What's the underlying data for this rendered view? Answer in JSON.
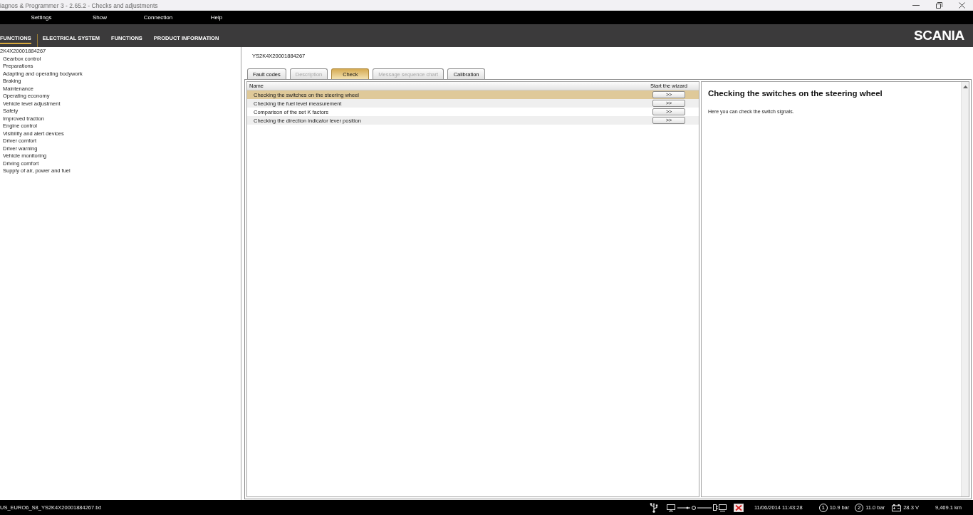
{
  "window": {
    "title": "iagnos & Programmer 3 - 2.65.2 - Checks and adjustments"
  },
  "menu": [
    {
      "label": "Settings"
    },
    {
      "label": "Show"
    },
    {
      "label": "Connection"
    },
    {
      "label": "Help"
    }
  ],
  "nav": {
    "items": [
      {
        "label": "FUNCTIONS",
        "selected": true
      },
      {
        "label": "ELECTRICAL SYSTEM",
        "selected": false
      },
      {
        "label": "FUNCTIONS",
        "selected": false
      },
      {
        "label": "PRODUCT INFORMATION",
        "selected": false
      }
    ],
    "logo": "SCANIA"
  },
  "sidebar": {
    "tree": {
      "label": "2K4X20001884267",
      "children": [
        {
          "label": "Gearbox control"
        },
        {
          "label": "Preparations"
        },
        {
          "label": "Adapting and operating bodywork"
        },
        {
          "label": "Braking"
        },
        {
          "label": "Maintenance"
        },
        {
          "label": "Operating economy"
        },
        {
          "label": "Vehicle level adjustment"
        },
        {
          "label": "Safety"
        },
        {
          "label": "Improved traction"
        },
        {
          "label": "Engine control"
        },
        {
          "label": "Visibility and alert devices"
        },
        {
          "label": "Driver comfort"
        },
        {
          "label": "Driver warning"
        },
        {
          "label": "Vehicle monitoring"
        },
        {
          "label": "Driving comfort"
        },
        {
          "label": "Supply of air, power and fuel"
        }
      ]
    }
  },
  "vehicle_id": "YS2K4X20001884267",
  "tabs": [
    {
      "label": "Fault codes",
      "selected": false,
      "disabled": false
    },
    {
      "label": "Description",
      "selected": false,
      "disabled": true
    },
    {
      "label": "Check",
      "selected": true,
      "disabled": false
    },
    {
      "label": "Message sequence chart",
      "selected": false,
      "disabled": true
    },
    {
      "label": "Calibration",
      "selected": false,
      "disabled": false
    }
  ],
  "table": {
    "columns": [
      "Name",
      "Start the wizard"
    ],
    "rows": [
      {
        "name": "Checking the switches on the steering wheel",
        "action": ">>",
        "selected": true
      },
      {
        "name": "Checking the fuel level measurement",
        "action": ">>",
        "selected": false
      },
      {
        "name": "Comparison of the set K factors",
        "action": ">>",
        "selected": false
      },
      {
        "name": "Checking the direction indicator lever position",
        "action": ">>",
        "selected": false
      }
    ]
  },
  "detail": {
    "title": "Checking the switches on the steering wheel",
    "text": "Here you can check the switch signals."
  },
  "status_bar": {
    "file": "US_EURO6_S8_YS2K4X20001884267.txt",
    "datetime": "11/06/2014 11:43:28",
    "readings": [
      {
        "kind": "circuit",
        "circuit": "1",
        "value": "10.9 bar"
      },
      {
        "kind": "circuit",
        "circuit": "2",
        "value": "11.0 bar"
      },
      {
        "kind": "battery",
        "value": "28.3 V"
      },
      {
        "kind": "plain",
        "value": "9,469.1 km"
      }
    ]
  }
}
